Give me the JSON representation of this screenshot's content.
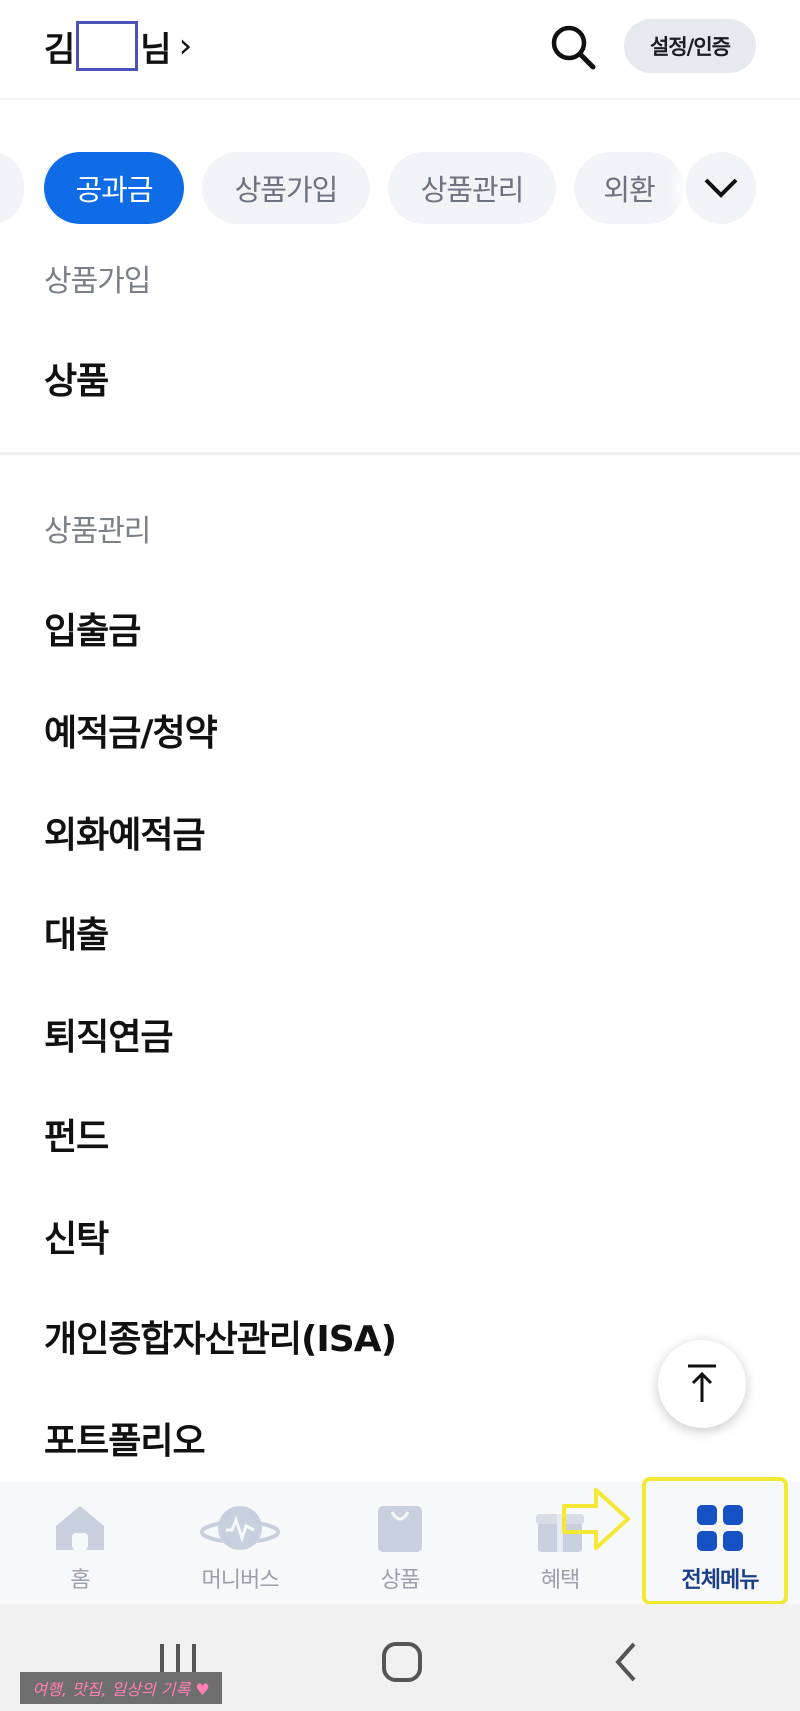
{
  "header": {
    "user_prefix": "김",
    "user_suffix": "님",
    "user_chevron": "›",
    "settings_label": "설정/인증"
  },
  "chips": [
    {
      "label": "공과금",
      "active": true
    },
    {
      "label": "상품가입",
      "active": false
    },
    {
      "label": "상품관리",
      "active": false
    },
    {
      "label": "외환",
      "active": false
    }
  ],
  "sections": [
    {
      "title": "상품가입",
      "items": [
        "상품"
      ]
    },
    {
      "title": "상품관리",
      "items": [
        "입출금",
        "예적금/청약",
        "외화예적금",
        "대출",
        "퇴직연금",
        "펀드",
        "신탁",
        "개인종합자산관리(ISA)",
        "포트폴리오"
      ]
    }
  ],
  "bottom_nav": [
    {
      "label": "홈",
      "icon": "home-icon"
    },
    {
      "label": "머니버스",
      "icon": "planet-icon"
    },
    {
      "label": "상품",
      "icon": "shopping-bag-icon"
    },
    {
      "label": "혜택",
      "icon": "gift-icon"
    },
    {
      "label": "전체메뉴",
      "icon": "grid-icon",
      "active": true
    }
  ],
  "watermark": "여행, 맛집, 일상의 기록 ♥",
  "colors": {
    "accent": "#0f6ce6",
    "nav_active": "#1b3f8a",
    "highlight": "#f3e833"
  }
}
